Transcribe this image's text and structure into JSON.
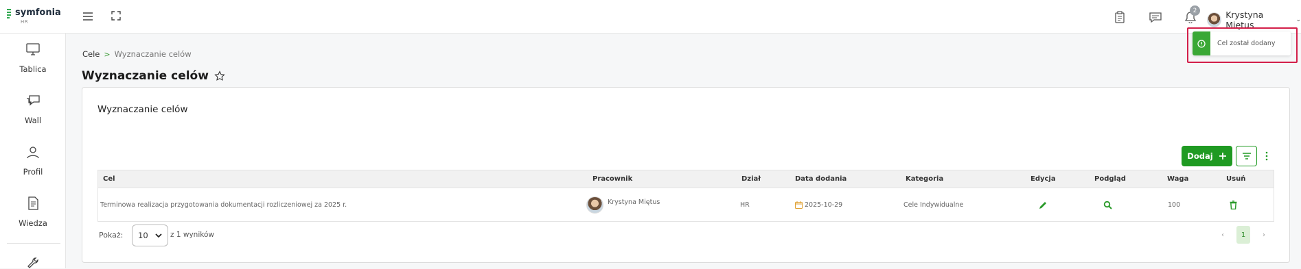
{
  "app": {
    "name": "symfonia",
    "sub": "HR"
  },
  "header": {
    "notifications_count": "2",
    "user_name": "Krystyna Miętus"
  },
  "toast": {
    "message": "Cel został dodany"
  },
  "sidebar": {
    "items": [
      {
        "label": "Tablica",
        "icon": "monitor-icon"
      },
      {
        "label": "Wall",
        "icon": "chat-bubbles-icon"
      },
      {
        "label": "Profil",
        "icon": "person-icon"
      },
      {
        "label": "Wiedza",
        "icon": "document-icon"
      },
      {
        "label": "",
        "icon": "wrench-icon"
      }
    ]
  },
  "breadcrumb": {
    "root": "Cele",
    "separator": ">",
    "current": "Wyznaczanie celów"
  },
  "page": {
    "title": "Wyznaczanie celów"
  },
  "card": {
    "title": "Wyznaczanie celów",
    "add_label": "Dodaj"
  },
  "table": {
    "columns": [
      "Cel",
      "Pracownik",
      "Dział",
      "Data dodania",
      "Kategoria",
      "Edycja",
      "Podgląd",
      "Waga",
      "Usuń"
    ],
    "rows": [
      {
        "cel": "Terminowa realizacja przygotowania dokumentacji rozliczeniowej za 2025 r.",
        "pracownik": "Krystyna Miętus",
        "dzial": "HR",
        "data": "2025-10-29",
        "kategoria": "Cele Indywidualne",
        "waga": "100"
      }
    ]
  },
  "pagination": {
    "show_label": "Pokaż:",
    "per_page": "10",
    "results": "z 1 wyników",
    "current_page": "1",
    "prev": "‹",
    "next": "›"
  },
  "colors": {
    "accent": "#1f9a22",
    "toast_outline": "#d31f49",
    "toast_side": "#3aa835"
  }
}
